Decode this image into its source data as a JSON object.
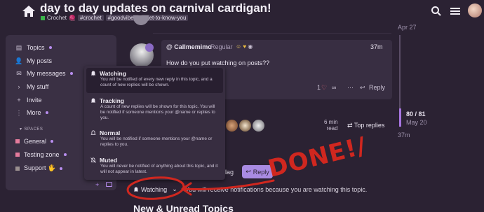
{
  "header": {
    "title": "day to day updates on carnival cardigan!",
    "category": "Crochet",
    "category_emoji": "🧶",
    "tags": [
      "#crochet",
      "#goodvibes",
      "#get-to-know-you"
    ]
  },
  "sidebar": {
    "items": [
      {
        "label": "Topics",
        "icon": "topics-icon",
        "dot": true
      },
      {
        "label": "My posts",
        "icon": "user-icon",
        "dot": false
      },
      {
        "label": "My messages",
        "icon": "inbox-icon",
        "dot": true
      },
      {
        "label": "My stuff",
        "icon": "chevron-right-icon",
        "dot": false
      },
      {
        "label": "Invite",
        "icon": "user-plus-icon",
        "dot": false
      },
      {
        "label": "More",
        "icon": "ellipsis-icon",
        "dot": true
      }
    ],
    "spaces_heading": "SPACES",
    "spaces": [
      {
        "label": "General",
        "color": "#e57b9c",
        "dot": true
      },
      {
        "label": "Testing zone",
        "color": "#e57b9c",
        "dot": true
      },
      {
        "label": "Support 🖐",
        "color": "#9a8f8f",
        "dot": true
      }
    ]
  },
  "timeline": {
    "top_date": "Apr 27",
    "position": "80 / 81",
    "current_date": "May 20",
    "bottom_date": "37m"
  },
  "post": {
    "username": "@ Callmemimo",
    "user_title": "Regular",
    "time": "37m",
    "body": "How do you put watching on posts??",
    "like_count": "1",
    "reply_label": "Reply"
  },
  "notifications_menu": {
    "options": [
      {
        "title": "Watching",
        "description": "You will be notified of every new reply in this topic, and a count of new replies will be shown."
      },
      {
        "title": "Tracking",
        "description": "A count of new replies will be shown for this topic. You will be notified if someone mentions your @name or replies to you."
      },
      {
        "title": "Normal",
        "description": "You will be notified if someone mentions your @name or replies to you."
      },
      {
        "title": "Muted",
        "description": "You will never be notified of anything about this topic, and it will not appear in latest."
      }
    ],
    "selected": "Watching"
  },
  "summary": {
    "read_time_value": "6 min",
    "read_time_unit": "read",
    "top_replies_label": "Top replies"
  },
  "footer": {
    "flag_label": "lag",
    "reply_label": "Reply",
    "watching_label": "Watching",
    "notification_text": "You will receive notifications because you are watching this topic.",
    "new_unread": "New & Unread Topics"
  },
  "annotation": {
    "text": "DONE!/",
    "color": "#d0271f"
  }
}
